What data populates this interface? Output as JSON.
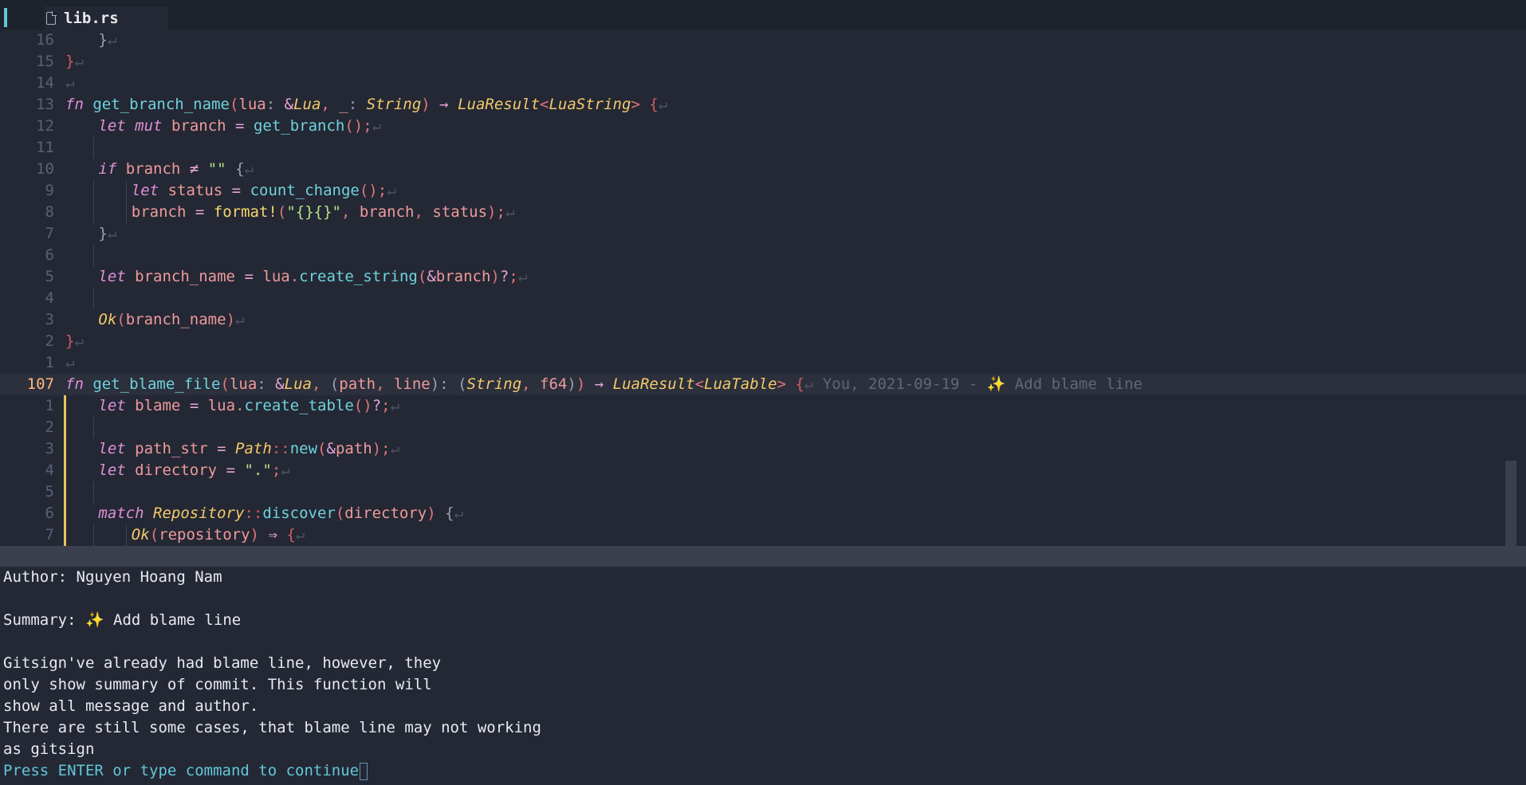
{
  "tab": {
    "filename": "lib.rs",
    "icon": "file-icon"
  },
  "colors": {
    "background": "#232834",
    "keyword": "#e08fd9",
    "function": "#6fd2dc",
    "type": "#f4c96a",
    "string": "#b6e089",
    "accent": "#61c7d8"
  },
  "lines": [
    {
      "num": "16",
      "indent": 1,
      "tokens": [
        [
          "pu",
          "}"
        ],
        [
          "ret",
          "↵"
        ]
      ]
    },
    {
      "num": "15",
      "indent": 0,
      "tokens": [
        [
          "br",
          "}"
        ],
        [
          "ret",
          "↵"
        ]
      ]
    },
    {
      "num": "14",
      "indent": 0,
      "tokens": [
        [
          "ret",
          "↵"
        ]
      ]
    },
    {
      "num": "13",
      "indent": 0,
      "tokens": [
        [
          "kw",
          "fn"
        ],
        [
          "pu",
          " "
        ],
        [
          "fn",
          "get_branch_name"
        ],
        [
          "pr",
          "("
        ],
        [
          "id",
          "lua"
        ],
        [
          "pu",
          ": "
        ],
        [
          "op",
          "&"
        ],
        [
          "ty",
          "Lua"
        ],
        [
          "pr",
          ", "
        ],
        [
          "id",
          "_"
        ],
        [
          "pu",
          ": "
        ],
        [
          "ty",
          "String"
        ],
        [
          "pr",
          ")"
        ],
        [
          "pu",
          " "
        ],
        [
          "op",
          "→"
        ],
        [
          "pu",
          " "
        ],
        [
          "ty",
          "LuaResult"
        ],
        [
          "pr",
          "<"
        ],
        [
          "ty",
          "LuaString"
        ],
        [
          "pr",
          ">"
        ],
        [
          "pu",
          " "
        ],
        [
          "br",
          "{"
        ],
        [
          "ret",
          "↵"
        ]
      ]
    },
    {
      "num": "12",
      "indent": 1,
      "tokens": [
        [
          "kw",
          "let"
        ],
        [
          "pu",
          " "
        ],
        [
          "kw",
          "mut"
        ],
        [
          "pu",
          " "
        ],
        [
          "id",
          "branch"
        ],
        [
          "pu",
          " "
        ],
        [
          "op",
          "="
        ],
        [
          "pu",
          " "
        ],
        [
          "fn",
          "get_branch"
        ],
        [
          "pr",
          "()"
        ],
        [
          "pr",
          ";"
        ],
        [
          "ret",
          "↵"
        ]
      ]
    },
    {
      "num": "11",
      "indent": 1,
      "tokens": []
    },
    {
      "num": "10",
      "indent": 1,
      "tokens": [
        [
          "kw",
          "if"
        ],
        [
          "pu",
          " "
        ],
        [
          "id",
          "branch"
        ],
        [
          "pu",
          " "
        ],
        [
          "op",
          "≠"
        ],
        [
          "pu",
          " "
        ],
        [
          "st",
          "\"\""
        ],
        [
          "pu",
          " {"
        ],
        [
          "ret",
          "↵"
        ]
      ]
    },
    {
      "num": "9",
      "indent": 2,
      "tokens": [
        [
          "kw",
          "let"
        ],
        [
          "pu",
          " "
        ],
        [
          "id",
          "status"
        ],
        [
          "pu",
          " "
        ],
        [
          "op",
          "="
        ],
        [
          "pu",
          " "
        ],
        [
          "fn",
          "count_change"
        ],
        [
          "pr",
          "()"
        ],
        [
          "pr",
          ";"
        ],
        [
          "ret",
          "↵"
        ]
      ]
    },
    {
      "num": "8",
      "indent": 2,
      "tokens": [
        [
          "id",
          "branch"
        ],
        [
          "pu",
          " "
        ],
        [
          "op",
          "="
        ],
        [
          "pu",
          " "
        ],
        [
          "mac",
          "format!"
        ],
        [
          "pr",
          "("
        ],
        [
          "st",
          "\"{}{}\""
        ],
        [
          "pr",
          ", "
        ],
        [
          "id",
          "branch"
        ],
        [
          "pr",
          ", "
        ],
        [
          "id",
          "status"
        ],
        [
          "pr",
          ")"
        ],
        [
          "pr",
          ";"
        ],
        [
          "ret",
          "↵"
        ]
      ]
    },
    {
      "num": "7",
      "indent": 1,
      "tokens": [
        [
          "pu",
          "}"
        ],
        [
          "ret",
          "↵"
        ]
      ]
    },
    {
      "num": "6",
      "indent": 1,
      "tokens": []
    },
    {
      "num": "5",
      "indent": 1,
      "tokens": [
        [
          "kw",
          "let"
        ],
        [
          "pu",
          " "
        ],
        [
          "id",
          "branch_name"
        ],
        [
          "pu",
          " "
        ],
        [
          "op",
          "="
        ],
        [
          "pu",
          " "
        ],
        [
          "id",
          "lua"
        ],
        [
          "dot",
          "."
        ],
        [
          "fn",
          "create_string"
        ],
        [
          "pr",
          "("
        ],
        [
          "op",
          "&"
        ],
        [
          "id",
          "branch"
        ],
        [
          "pr",
          ")"
        ],
        [
          "op",
          "?"
        ],
        [
          "pr",
          ";"
        ],
        [
          "ret",
          "↵"
        ]
      ]
    },
    {
      "num": "4",
      "indent": 1,
      "tokens": []
    },
    {
      "num": "3",
      "indent": 1,
      "tokens": [
        [
          "ty",
          "Ok"
        ],
        [
          "pr",
          "("
        ],
        [
          "id",
          "branch_name"
        ],
        [
          "pr",
          ")"
        ],
        [
          "ret",
          "↵"
        ]
      ]
    },
    {
      "num": "2",
      "indent": 0,
      "tokens": [
        [
          "br",
          "}"
        ],
        [
          "ret",
          "↵"
        ]
      ]
    },
    {
      "num": "1",
      "indent": 0,
      "tokens": [
        [
          "ret",
          "↵"
        ]
      ]
    },
    {
      "num": "107",
      "indent": 0,
      "current": true,
      "tokens": [
        [
          "kw",
          "fn"
        ],
        [
          "pu",
          " "
        ],
        [
          "fn",
          "get_blame_file"
        ],
        [
          "pr",
          "("
        ],
        [
          "id",
          "lua"
        ],
        [
          "pu",
          ": "
        ],
        [
          "op",
          "&"
        ],
        [
          "ty",
          "Lua"
        ],
        [
          "pr",
          ", "
        ],
        [
          "pu",
          "("
        ],
        [
          "id",
          "path"
        ],
        [
          "pr",
          ", "
        ],
        [
          "id",
          "line"
        ],
        [
          "pu",
          ")"
        ],
        [
          "pu",
          ": "
        ],
        [
          "pu",
          "("
        ],
        [
          "ty",
          "String"
        ],
        [
          "pr",
          ", "
        ],
        [
          "id",
          "f64"
        ],
        [
          "pu",
          ")"
        ],
        [
          "pr",
          ")"
        ],
        [
          "pu",
          " "
        ],
        [
          "op",
          "→"
        ],
        [
          "pu",
          " "
        ],
        [
          "ty",
          "LuaResult"
        ],
        [
          "pr",
          "<"
        ],
        [
          "ty",
          "LuaTable"
        ],
        [
          "pr",
          ">"
        ],
        [
          "pu",
          " "
        ],
        [
          "br",
          "{"
        ],
        [
          "ret",
          "↵"
        ],
        [
          "blame",
          " You, 2021-09-19 - ✨ Add blame line"
        ]
      ]
    },
    {
      "num": "1",
      "indent": 1,
      "git": true,
      "tokens": [
        [
          "kw",
          "let"
        ],
        [
          "pu",
          " "
        ],
        [
          "id",
          "blame"
        ],
        [
          "pu",
          " "
        ],
        [
          "op",
          "="
        ],
        [
          "pu",
          " "
        ],
        [
          "id",
          "lua"
        ],
        [
          "dot",
          "."
        ],
        [
          "fn",
          "create_table"
        ],
        [
          "pr",
          "()"
        ],
        [
          "op",
          "?"
        ],
        [
          "pr",
          ";"
        ],
        [
          "ret",
          "↵"
        ]
      ]
    },
    {
      "num": "2",
      "indent": 1,
      "git": true,
      "tokens": []
    },
    {
      "num": "3",
      "indent": 1,
      "git": true,
      "tokens": [
        [
          "kw",
          "let"
        ],
        [
          "pu",
          " "
        ],
        [
          "id",
          "path_str"
        ],
        [
          "pu",
          " "
        ],
        [
          "op",
          "="
        ],
        [
          "pu",
          " "
        ],
        [
          "ty",
          "Path"
        ],
        [
          "br",
          "::"
        ],
        [
          "fn",
          "new"
        ],
        [
          "pr",
          "("
        ],
        [
          "op",
          "&"
        ],
        [
          "id",
          "path"
        ],
        [
          "pr",
          ")"
        ],
        [
          "pr",
          ";"
        ],
        [
          "ret",
          "↵"
        ]
      ]
    },
    {
      "num": "4",
      "indent": 1,
      "git": true,
      "tokens": [
        [
          "kw",
          "let"
        ],
        [
          "pu",
          " "
        ],
        [
          "id",
          "directory"
        ],
        [
          "pu",
          " "
        ],
        [
          "op",
          "="
        ],
        [
          "pu",
          " "
        ],
        [
          "st",
          "\".\""
        ],
        [
          "pr",
          ";"
        ],
        [
          "ret",
          "↵"
        ]
      ]
    },
    {
      "num": "5",
      "indent": 1,
      "git": true,
      "tokens": []
    },
    {
      "num": "6",
      "indent": 1,
      "git": true,
      "tokens": [
        [
          "kw",
          "match"
        ],
        [
          "pu",
          " "
        ],
        [
          "ty",
          "Repository"
        ],
        [
          "br",
          "::"
        ],
        [
          "fn",
          "discover"
        ],
        [
          "pr",
          "("
        ],
        [
          "id",
          "directory"
        ],
        [
          "pr",
          ")"
        ],
        [
          "pu",
          " {"
        ],
        [
          "ret",
          "↵"
        ]
      ]
    },
    {
      "num": "7",
      "indent": 2,
      "git": true,
      "tokens": [
        [
          "ty",
          "Ok"
        ],
        [
          "pr",
          "("
        ],
        [
          "id",
          "repository"
        ],
        [
          "pr",
          ")"
        ],
        [
          "pu",
          " "
        ],
        [
          "op",
          "⇒"
        ],
        [
          "pu",
          " "
        ],
        [
          "br",
          "{"
        ],
        [
          "ret",
          "↵"
        ]
      ]
    }
  ],
  "message": {
    "lines": [
      "Author: Nguyen Hoang Nam",
      "",
      "Summary: ✨ Add blame line",
      "",
      "Gitsign've already had blame line, however, they",
      "only show summary of commit. This function will",
      "show all message and author.",
      "There are still some cases, that blame line may not working",
      "as gitsign"
    ],
    "prompt": "Press ENTER or type command to continue"
  }
}
